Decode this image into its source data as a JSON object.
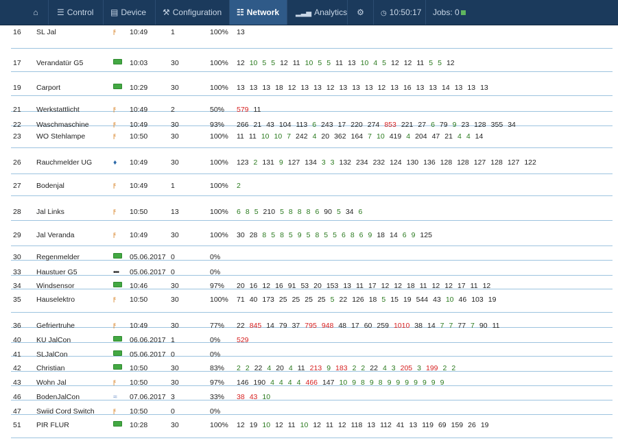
{
  "nav": {
    "home_icon": "home-icon",
    "items": [
      {
        "label": "Control",
        "icon": "sliders-icon"
      },
      {
        "label": "Device",
        "icon": "database-icon"
      },
      {
        "label": "Configuration",
        "icon": "wrench-icon"
      },
      {
        "label": "Network",
        "icon": "sitemap-icon",
        "active": true
      },
      {
        "label": "Analytics",
        "icon": "signal-icon"
      }
    ],
    "settings_icon": "gear-icon",
    "clock": "10:50:17",
    "jobs_label": "Jobs: 0"
  },
  "colors": {
    "nav_bg": "#1b3a5c",
    "nav_active": "#2f5a88",
    "good": "#2a7a1e",
    "bad": "#d62020",
    "row_border": "#9cc3df"
  },
  "rows": [
    {
      "id": "16",
      "name": "SL Jal",
      "type": "bolt",
      "time": "10:49",
      "count": "1",
      "pct": "100%",
      "vals": [
        [
          "13",
          ""
        ]
      ]
    },
    {
      "id": "17",
      "name": "Verandatür G5",
      "type": "battery",
      "time": "10:03",
      "count": "30",
      "pct": "100%",
      "vals": [
        [
          "12",
          ""
        ],
        [
          "10",
          "g"
        ],
        [
          "5",
          "g"
        ],
        [
          "5",
          "g"
        ],
        [
          "12",
          ""
        ],
        [
          "11",
          ""
        ],
        [
          "10",
          "g"
        ],
        [
          "5",
          "g"
        ],
        [
          "5",
          "g"
        ],
        [
          "11",
          ""
        ],
        [
          "13",
          ""
        ],
        [
          "10",
          "g"
        ],
        [
          "4",
          "g"
        ],
        [
          "5",
          "g"
        ],
        [
          "12",
          ""
        ],
        [
          "12",
          ""
        ],
        [
          "11",
          ""
        ],
        [
          "5",
          "g"
        ],
        [
          "5",
          "g"
        ],
        [
          "12",
          ""
        ]
      ]
    },
    {
      "id": "19",
      "name": "Carport",
      "type": "battery",
      "time": "10:29",
      "count": "30",
      "pct": "100%",
      "vals": [
        [
          "13",
          ""
        ],
        [
          "13",
          ""
        ],
        [
          "13",
          ""
        ],
        [
          "18",
          ""
        ],
        [
          "12",
          ""
        ],
        [
          "13",
          ""
        ],
        [
          "13",
          ""
        ],
        [
          "12",
          ""
        ],
        [
          "13",
          ""
        ],
        [
          "13",
          ""
        ],
        [
          "13",
          ""
        ],
        [
          "12",
          ""
        ],
        [
          "13",
          ""
        ],
        [
          "16",
          ""
        ],
        [
          "13",
          ""
        ],
        [
          "13",
          ""
        ],
        [
          "14",
          ""
        ],
        [
          "13",
          ""
        ],
        [
          "13",
          ""
        ],
        [
          "13",
          ""
        ]
      ]
    },
    {
      "id": "21",
      "name": "Werkstattlicht",
      "type": "bolt",
      "time": "10:49",
      "count": "2",
      "pct": "50%",
      "vals": [
        [
          "579",
          "r"
        ],
        [
          "11",
          ""
        ]
      ]
    },
    {
      "id": "22",
      "name": "Waschmaschine",
      "type": "bolt",
      "time": "10:49",
      "count": "30",
      "pct": "93%",
      "vals": [
        [
          "266",
          ""
        ],
        [
          "21",
          ""
        ],
        [
          "43",
          ""
        ],
        [
          "104",
          ""
        ],
        [
          "113",
          ""
        ],
        [
          "6",
          "g"
        ],
        [
          "243",
          ""
        ],
        [
          "17",
          ""
        ],
        [
          "220",
          ""
        ],
        [
          "274",
          ""
        ],
        [
          "853",
          "r"
        ],
        [
          "221",
          ""
        ],
        [
          "27",
          ""
        ],
        [
          "6",
          "g"
        ],
        [
          "79",
          ""
        ],
        [
          "9",
          "g"
        ],
        [
          "23",
          ""
        ],
        [
          "128",
          ""
        ],
        [
          "355",
          ""
        ],
        [
          "34",
          ""
        ]
      ]
    },
    {
      "id": "23",
      "name": "WO Stehlampe",
      "type": "bolt",
      "time": "10:50",
      "count": "30",
      "pct": "100%",
      "vals": [
        [
          "11",
          ""
        ],
        [
          "11",
          ""
        ],
        [
          "10",
          "g"
        ],
        [
          "10",
          "g"
        ],
        [
          "7",
          "g"
        ],
        [
          "242",
          ""
        ],
        [
          "4",
          "g"
        ],
        [
          "20",
          ""
        ],
        [
          "362",
          ""
        ],
        [
          "164",
          ""
        ],
        [
          "7",
          "g"
        ],
        [
          "10",
          "g"
        ],
        [
          "419",
          ""
        ],
        [
          "4",
          "g"
        ],
        [
          "204",
          ""
        ],
        [
          "47",
          ""
        ],
        [
          "21",
          ""
        ],
        [
          "4",
          "g"
        ],
        [
          "4",
          "g"
        ],
        [
          "14",
          ""
        ]
      ]
    },
    {
      "id": "26",
      "name": "Rauchmelder UG",
      "type": "drop",
      "time": "10:49",
      "count": "30",
      "pct": "100%",
      "vals": [
        [
          "123",
          ""
        ],
        [
          "2",
          "g"
        ],
        [
          "131",
          ""
        ],
        [
          "9",
          "g"
        ],
        [
          "127",
          ""
        ],
        [
          "134",
          ""
        ],
        [
          "3",
          "g"
        ],
        [
          "3",
          "g"
        ],
        [
          "132",
          ""
        ],
        [
          "234",
          ""
        ],
        [
          "232",
          ""
        ],
        [
          "124",
          ""
        ],
        [
          "130",
          ""
        ],
        [
          "136",
          ""
        ],
        [
          "128",
          ""
        ],
        [
          "128",
          ""
        ],
        [
          "127",
          ""
        ],
        [
          "128",
          ""
        ],
        [
          "127",
          ""
        ],
        [
          "122",
          ""
        ]
      ]
    },
    {
      "id": "27",
      "name": "Bodenjal",
      "type": "bolt",
      "time": "10:49",
      "count": "1",
      "pct": "100%",
      "vals": [
        [
          "2",
          "g"
        ]
      ]
    },
    {
      "id": "28",
      "name": "Jal Links",
      "type": "bolt",
      "time": "10:50",
      "count": "13",
      "pct": "100%",
      "vals": [
        [
          "6",
          "g"
        ],
        [
          "8",
          "g"
        ],
        [
          "5",
          "g"
        ],
        [
          "210",
          ""
        ],
        [
          "5",
          "g"
        ],
        [
          "8",
          "g"
        ],
        [
          "8",
          "g"
        ],
        [
          "8",
          "g"
        ],
        [
          "6",
          "g"
        ],
        [
          "90",
          ""
        ],
        [
          "5",
          "g"
        ],
        [
          "34",
          ""
        ],
        [
          "6",
          "g"
        ]
      ]
    },
    {
      "id": "29",
      "name": "Jal Veranda",
      "type": "bolt",
      "time": "10:49",
      "count": "30",
      "pct": "100%",
      "vals": [
        [
          "30",
          ""
        ],
        [
          "28",
          ""
        ],
        [
          "8",
          "g"
        ],
        [
          "5",
          "g"
        ],
        [
          "8",
          "g"
        ],
        [
          "5",
          "g"
        ],
        [
          "9",
          "g"
        ],
        [
          "5",
          "g"
        ],
        [
          "8",
          "g"
        ],
        [
          "5",
          "g"
        ],
        [
          "5",
          "g"
        ],
        [
          "6",
          "g"
        ],
        [
          "8",
          "g"
        ],
        [
          "6",
          "g"
        ],
        [
          "9",
          "g"
        ],
        [
          "18",
          ""
        ],
        [
          "14",
          ""
        ],
        [
          "6",
          "g"
        ],
        [
          "9",
          "g"
        ],
        [
          "125",
          ""
        ]
      ]
    },
    {
      "id": "30",
      "name": "Regenmelder",
      "type": "battery",
      "time": "05.06.2017",
      "count": "0",
      "pct": "0%",
      "vals": []
    },
    {
      "id": "33",
      "name": "Haustuer G5",
      "type": "dots",
      "time": "05.06.2017",
      "count": "0",
      "pct": "0%",
      "vals": []
    },
    {
      "id": "34",
      "name": "Windsensor",
      "type": "battery",
      "time": "10:46",
      "count": "30",
      "pct": "97%",
      "vals": [
        [
          "20",
          ""
        ],
        [
          "16",
          ""
        ],
        [
          "12",
          ""
        ],
        [
          "16",
          ""
        ],
        [
          "91",
          ""
        ],
        [
          "53",
          ""
        ],
        [
          "20",
          ""
        ],
        [
          "153",
          ""
        ],
        [
          "13",
          ""
        ],
        [
          "11",
          ""
        ],
        [
          "17",
          ""
        ],
        [
          "12",
          ""
        ],
        [
          "12",
          ""
        ],
        [
          "18",
          ""
        ],
        [
          "11",
          ""
        ],
        [
          "12",
          ""
        ],
        [
          "12",
          ""
        ],
        [
          "17",
          ""
        ],
        [
          "11",
          ""
        ],
        [
          "12",
          ""
        ]
      ]
    },
    {
      "id": "35",
      "name": "Hauselektro",
      "type": "bolt",
      "time": "10:50",
      "count": "30",
      "pct": "100%",
      "vals": [
        [
          "71",
          ""
        ],
        [
          "40",
          ""
        ],
        [
          "173",
          ""
        ],
        [
          "25",
          ""
        ],
        [
          "25",
          ""
        ],
        [
          "25",
          ""
        ],
        [
          "25",
          ""
        ],
        [
          "5",
          "g"
        ],
        [
          "22",
          ""
        ],
        [
          "126",
          ""
        ],
        [
          "18",
          ""
        ],
        [
          "5",
          "g"
        ],
        [
          "15",
          ""
        ],
        [
          "19",
          ""
        ],
        [
          "544",
          ""
        ],
        [
          "43",
          ""
        ],
        [
          "10",
          "g"
        ],
        [
          "46",
          ""
        ],
        [
          "103",
          ""
        ],
        [
          "19",
          ""
        ]
      ]
    },
    {
      "id": "36",
      "name": "Gefriertruhe",
      "type": "bolt",
      "time": "10:49",
      "count": "30",
      "pct": "77%",
      "vals": [
        [
          "22",
          ""
        ],
        [
          "845",
          "r"
        ],
        [
          "14",
          ""
        ],
        [
          "79",
          ""
        ],
        [
          "37",
          ""
        ],
        [
          "795",
          "r"
        ],
        [
          "948",
          "r"
        ],
        [
          "48",
          ""
        ],
        [
          "17",
          ""
        ],
        [
          "60",
          ""
        ],
        [
          "259",
          ""
        ],
        [
          "1010",
          "r"
        ],
        [
          "38",
          ""
        ],
        [
          "14",
          ""
        ],
        [
          "7",
          "g"
        ],
        [
          "7",
          "g"
        ],
        [
          "77",
          ""
        ],
        [
          "7",
          "g"
        ],
        [
          "90",
          ""
        ],
        [
          "11",
          ""
        ]
      ]
    },
    {
      "id": "40",
      "name": "KU JalCon",
      "type": "battery",
      "time": "06.06.2017",
      "count": "1",
      "pct": "0%",
      "vals": [
        [
          "529",
          "r"
        ]
      ]
    },
    {
      "id": "41",
      "name": "SLJalCon",
      "type": "battery",
      "time": "05.06.2017",
      "count": "0",
      "pct": "0%",
      "vals": []
    },
    {
      "id": "42",
      "name": "Christian",
      "type": "battery",
      "time": "10:50",
      "count": "30",
      "pct": "83%",
      "vals": [
        [
          "2",
          "g"
        ],
        [
          "2",
          "g"
        ],
        [
          "22",
          ""
        ],
        [
          "4",
          "g"
        ],
        [
          "20",
          ""
        ],
        [
          "4",
          "g"
        ],
        [
          "11",
          ""
        ],
        [
          "213",
          "r"
        ],
        [
          "9",
          "g"
        ],
        [
          "183",
          "r"
        ],
        [
          "2",
          "g"
        ],
        [
          "2",
          "g"
        ],
        [
          "22",
          ""
        ],
        [
          "4",
          "g"
        ],
        [
          "3",
          "g"
        ],
        [
          "205",
          "r"
        ],
        [
          "3",
          "g"
        ],
        [
          "199",
          "r"
        ],
        [
          "2",
          "g"
        ],
        [
          "2",
          "g"
        ]
      ]
    },
    {
      "id": "43",
      "name": "Wohn Jal",
      "type": "bolt",
      "time": "10:50",
      "count": "30",
      "pct": "97%",
      "vals": [
        [
          "146",
          ""
        ],
        [
          "190",
          ""
        ],
        [
          "4",
          "g"
        ],
        [
          "4",
          "g"
        ],
        [
          "4",
          "g"
        ],
        [
          "4",
          "g"
        ],
        [
          "466",
          "r"
        ],
        [
          "147",
          ""
        ],
        [
          "10",
          "g"
        ],
        [
          "9",
          "g"
        ],
        [
          "8",
          "g"
        ],
        [
          "9",
          "g"
        ],
        [
          "8",
          "g"
        ],
        [
          "9",
          "g"
        ],
        [
          "9",
          "g"
        ],
        [
          "9",
          "g"
        ],
        [
          "9",
          "g"
        ],
        [
          "9",
          "g"
        ],
        [
          "9",
          "g"
        ],
        [
          "9",
          "g"
        ]
      ]
    },
    {
      "id": "46",
      "name": "BodenJalCon",
      "type": "wifi",
      "time": "07.06.2017",
      "count": "3",
      "pct": "33%",
      "vals": [
        [
          "38",
          "r"
        ],
        [
          "43",
          "r"
        ],
        [
          "10",
          "g"
        ]
      ]
    },
    {
      "id": "47",
      "name": "Swiid Cord Switch",
      "type": "bolt",
      "time": "10:50",
      "count": "0",
      "pct": "0%",
      "vals": []
    },
    {
      "id": "51",
      "name": "PIR FLUR",
      "type": "battery",
      "time": "10:28",
      "count": "30",
      "pct": "100%",
      "vals": [
        [
          "12",
          ""
        ],
        [
          "19",
          ""
        ],
        [
          "10",
          "g"
        ],
        [
          "12",
          ""
        ],
        [
          "11",
          ""
        ],
        [
          "10",
          "g"
        ],
        [
          "12",
          ""
        ],
        [
          "11",
          ""
        ],
        [
          "12",
          ""
        ],
        [
          "118",
          ""
        ],
        [
          "13",
          ""
        ],
        [
          "112",
          ""
        ],
        [
          "41",
          ""
        ],
        [
          "13",
          ""
        ],
        [
          "119",
          ""
        ],
        [
          "69",
          ""
        ],
        [
          "159",
          ""
        ],
        [
          "26",
          ""
        ],
        [
          "19",
          ""
        ]
      ]
    }
  ]
}
